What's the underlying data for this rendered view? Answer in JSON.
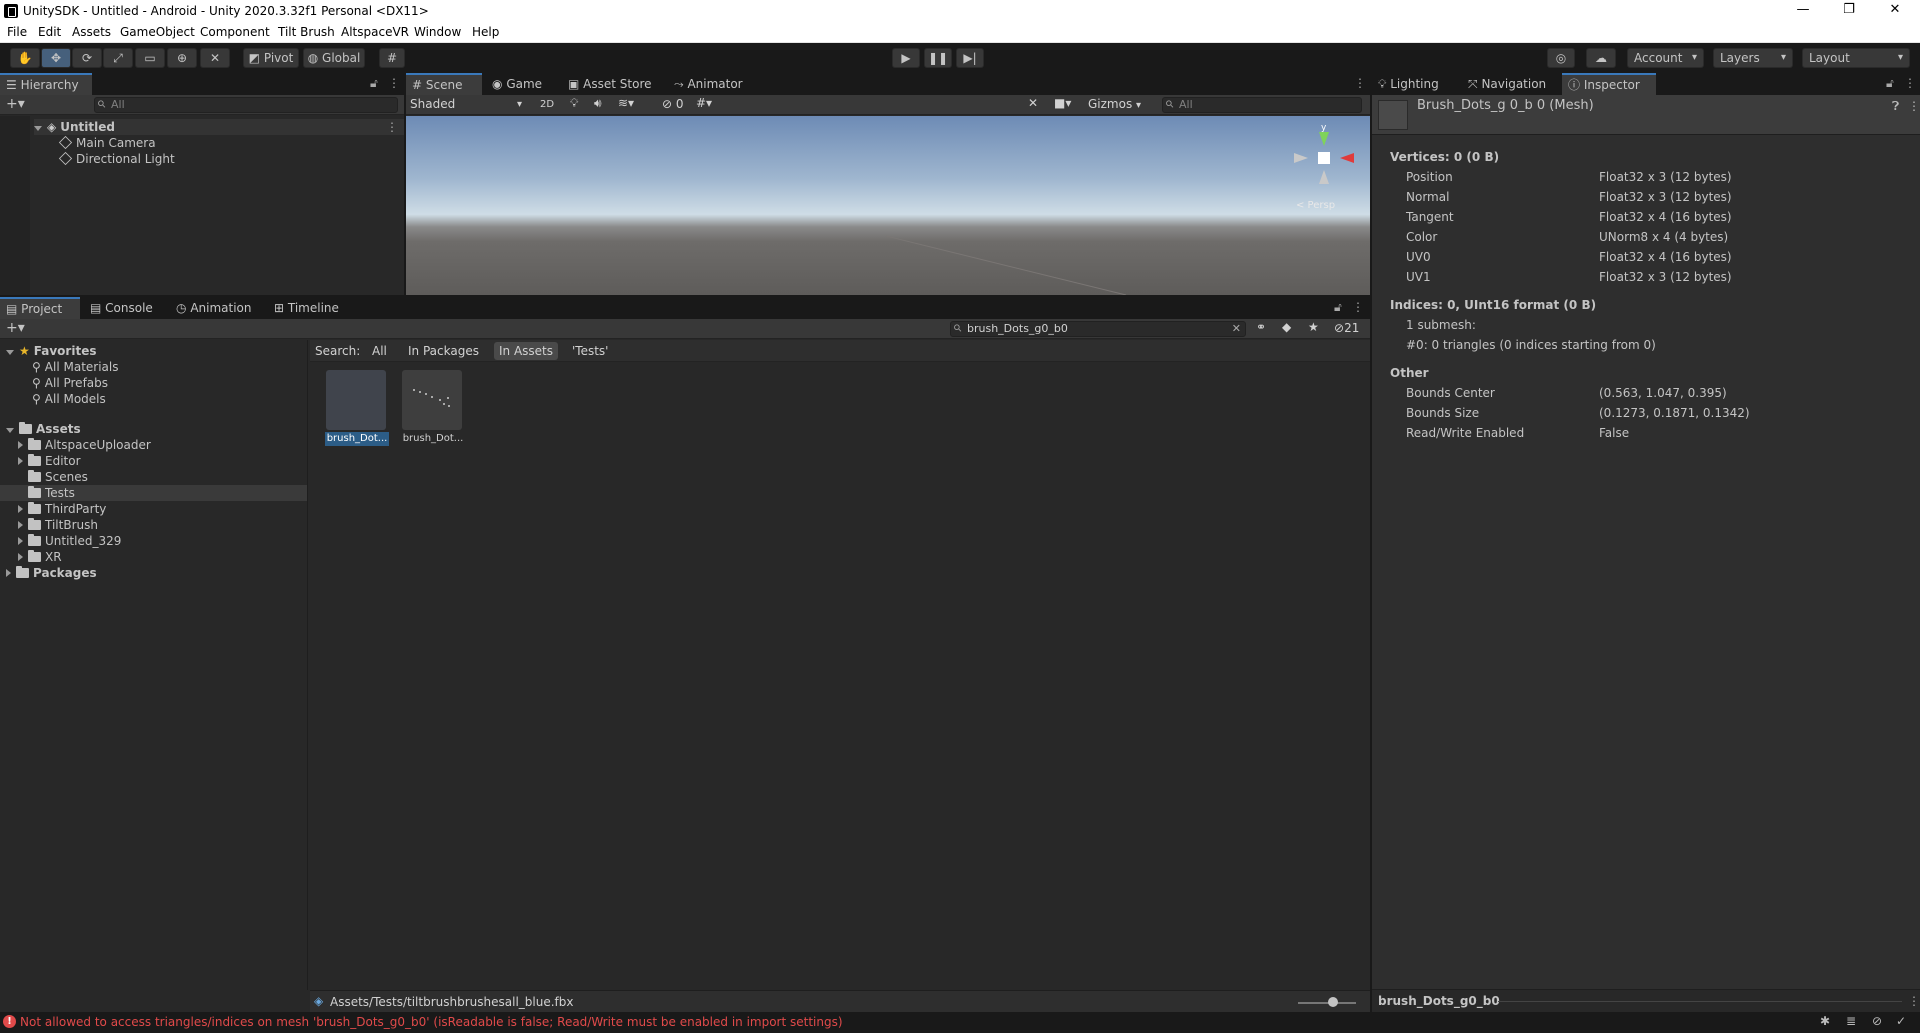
{
  "window": {
    "title": "UnitySDK - Untitled - Android - Unity 2020.3.32f1 Personal <DX11>",
    "controls": [
      "—",
      "❐",
      "✕"
    ]
  },
  "menu": [
    "File",
    "Edit",
    "Assets",
    "GameObject",
    "Component",
    "Tilt Brush",
    "AltspaceVR",
    "Window",
    "Help"
  ],
  "toolbar": {
    "pivot": "Pivot",
    "global": "Global",
    "account": "Account",
    "layers": "Layers",
    "layout": "Layout"
  },
  "hierarchy": {
    "tab": "Hierarchy",
    "search_placeholder": "All",
    "scene": "Untitled",
    "objects": [
      "Main Camera",
      "Directional Light"
    ]
  },
  "scene_view": {
    "tabs": [
      "Scene",
      "Game",
      "Asset Store",
      "Animator"
    ],
    "shading": "Shaded",
    "mode_2d": "2D",
    "hidden_count": "0",
    "gizmos": "Gizmos",
    "search_placeholder": "All",
    "gizmo_label": "< Persp"
  },
  "inspector": {
    "tabs": [
      "Lighting",
      "Navigation",
      "Inspector"
    ],
    "object_name": "Brush_Dots_g 0_b 0 (Mesh)",
    "vertices_header": "Vertices: 0 (0 B)",
    "vertices": [
      {
        "name": "Position",
        "value": "Float32 x 3 (12 bytes)"
      },
      {
        "name": "Normal",
        "value": "Float32 x 3 (12 bytes)"
      },
      {
        "name": "Tangent",
        "value": "Float32 x 4 (16 bytes)"
      },
      {
        "name": "Color",
        "value": "UNorm8 x 4 (4 bytes)"
      },
      {
        "name": "UV0",
        "value": "Float32 x 4 (16 bytes)"
      },
      {
        "name": "UV1",
        "value": "Float32 x 3 (12 bytes)"
      }
    ],
    "indices_header": "Indices: 0, UInt16 format (0 B)",
    "submesh": "1 submesh:",
    "submesh_detail": "#0: 0 triangles (0 indices starting from 0)",
    "other_header": "Other",
    "other": [
      {
        "name": "Bounds Center",
        "value": "(0.563, 1.047, 0.395)"
      },
      {
        "name": "Bounds Size",
        "value": "(0.1273, 0.1871, 0.1342)"
      },
      {
        "name": "Read/Write Enabled",
        "value": "False"
      }
    ],
    "footer_name": "brush_Dots_g0_b0"
  },
  "project": {
    "tabs": [
      "Project",
      "Console",
      "Animation",
      "Timeline"
    ],
    "search_value": "brush_Dots_g0_b0",
    "filter_count": "21",
    "search_label": "Search:",
    "scopes": [
      "All",
      "In Packages",
      "In Assets",
      "'Tests'"
    ],
    "favorites_label": "Favorites",
    "favorites": [
      "All Materials",
      "All Prefabs",
      "All Models"
    ],
    "assets_label": "Assets",
    "folders": [
      "AltspaceUploader",
      "Editor",
      "Scenes",
      "Tests",
      "ThirdParty",
      "TiltBrush",
      "Untitled_329",
      "XR"
    ],
    "packages_label": "Packages",
    "items": [
      "brush_Dot...",
      "brush_Dot..."
    ],
    "path": "Assets/Tests/tiltbrushbrushesall_blue.fbx"
  },
  "status": {
    "error": "Not allowed to access triangles/indices on mesh 'brush_Dots_g0_b0' (isReadable is false; Read/Write must be enabled in import settings)",
    "error_color": "#e04a4a"
  },
  "colors": {
    "accent": "#3a79bb",
    "selection": "#2c5d87"
  }
}
